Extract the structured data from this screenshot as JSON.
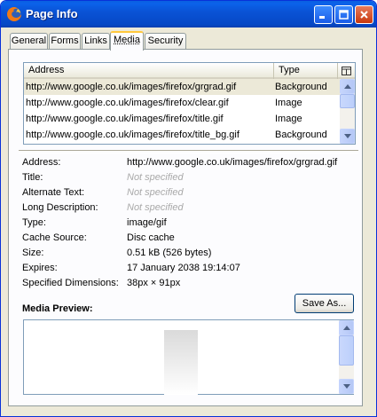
{
  "window": {
    "title": "Page Info"
  },
  "tabs": [
    {
      "label": "General"
    },
    {
      "label": "Forms"
    },
    {
      "label": "Links"
    },
    {
      "label": "Media",
      "active": true
    },
    {
      "label": "Security"
    }
  ],
  "media_list": {
    "columns": [
      "Address",
      "Type"
    ],
    "rows": [
      {
        "address": "http://www.google.co.uk/images/firefox/grgrad.gif",
        "type": "Background",
        "selected": true
      },
      {
        "address": "http://www.google.co.uk/images/firefox/clear.gif",
        "type": "Image"
      },
      {
        "address": "http://www.google.co.uk/images/firefox/title.gif",
        "type": "Image"
      },
      {
        "address": "http://www.google.co.uk/images/firefox/title_bg.gif",
        "type": "Background"
      }
    ]
  },
  "properties": [
    {
      "label": "Address:",
      "value": "http://www.google.co.uk/images/firefox/grgrad.gif",
      "not_specified": false
    },
    {
      "label": "Title:",
      "value": "Not specified",
      "not_specified": true
    },
    {
      "label": "Alternate Text:",
      "value": "Not specified",
      "not_specified": true
    },
    {
      "label": "Long Description:",
      "value": "Not specified",
      "not_specified": true
    },
    {
      "label": "Type:",
      "value": "image/gif",
      "not_specified": false
    },
    {
      "label": "Cache Source:",
      "value": "Disc cache",
      "not_specified": false
    },
    {
      "label": "Size:",
      "value": "0.51 kB (526 bytes)",
      "not_specified": false
    },
    {
      "label": "Expires:",
      "value": "17 January 2038 19:14:07",
      "not_specified": false
    },
    {
      "label": "Specified Dimensions:",
      "value": "38px × 91px",
      "not_specified": false
    }
  ],
  "save_as_label": "Save As...",
  "media_preview_label": "Media Preview:",
  "colors": {
    "titlebar": "#0a53d6",
    "dialog_bg": "#ece9d8",
    "active_tab_highlight": "#ffc83c",
    "not_specified_text": "#a9a9a9"
  },
  "icons": [
    "firefox-icon",
    "minimize-icon",
    "maximize-icon",
    "close-icon",
    "column-picker-icon",
    "arrow-up-icon",
    "arrow-down-icon"
  ]
}
